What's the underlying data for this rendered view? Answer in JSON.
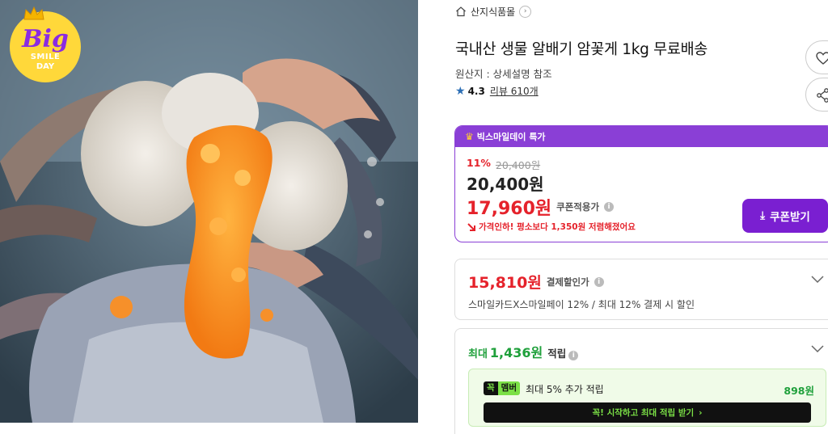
{
  "badge": {
    "big": "Big",
    "smile": "SMILE",
    "day": "DAY"
  },
  "breadcrumb": {
    "category": "산지식품몰",
    "chevron": "›"
  },
  "product": {
    "title": "국내산 생물 알배기 암꽃게 1kg 무료배송",
    "origin": "원산지 : 상세설명 참조",
    "rating": "4.3",
    "reviews": "리뷰 610개"
  },
  "deal": {
    "header": "빅스마일데이 특가",
    "discount_pct": "11%",
    "original_price": "20,400원",
    "sale_price": "20,400원",
    "coupon_price": "17,960원",
    "coupon_label": "쿠폰적용가",
    "alert": "가격인하! 평소보다 1,350원 저렴해졌어요",
    "coupon_button": "쿠폰받기",
    "accent_color": "#8a3fd6"
  },
  "payment": {
    "price": "15,810원",
    "label": "결제할인가",
    "desc": "스마일카드X스마일페이 12% / 최대 12% 결제 시 할인"
  },
  "points": {
    "max_prefix": "최대",
    "max_value": "1,436원",
    "max_suffix": "적립",
    "badge_a": "꼭",
    "badge_b": "멤버",
    "extra": "최대 5% 추가 적립",
    "extra_points": "898원",
    "start_button": "꼭! 시작하고 최대 적립 받기",
    "start_arrow": "›"
  },
  "icons": {
    "info": "i",
    "star": "★",
    "crown": "♛",
    "download": "⤓"
  }
}
